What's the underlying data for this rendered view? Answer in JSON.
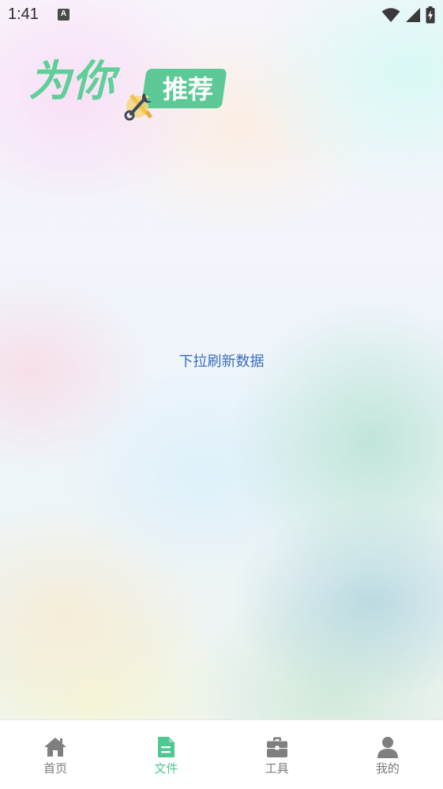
{
  "status_bar": {
    "time": "1:41",
    "notification_icon": "A"
  },
  "banner": {
    "big_text": "为你",
    "small_text": "推荐",
    "accent_color": "#5fcf98"
  },
  "main": {
    "refresh_hint": "下拉刷新数据"
  },
  "bottom_nav": {
    "active_color": "#4fc790",
    "inactive_color": "#7a7a7a",
    "items": [
      {
        "label": "首页",
        "icon": "home-icon"
      },
      {
        "label": "文件",
        "icon": "file-icon"
      },
      {
        "label": "工具",
        "icon": "toolbox-icon"
      },
      {
        "label": "我的",
        "icon": "user-icon"
      }
    ]
  }
}
